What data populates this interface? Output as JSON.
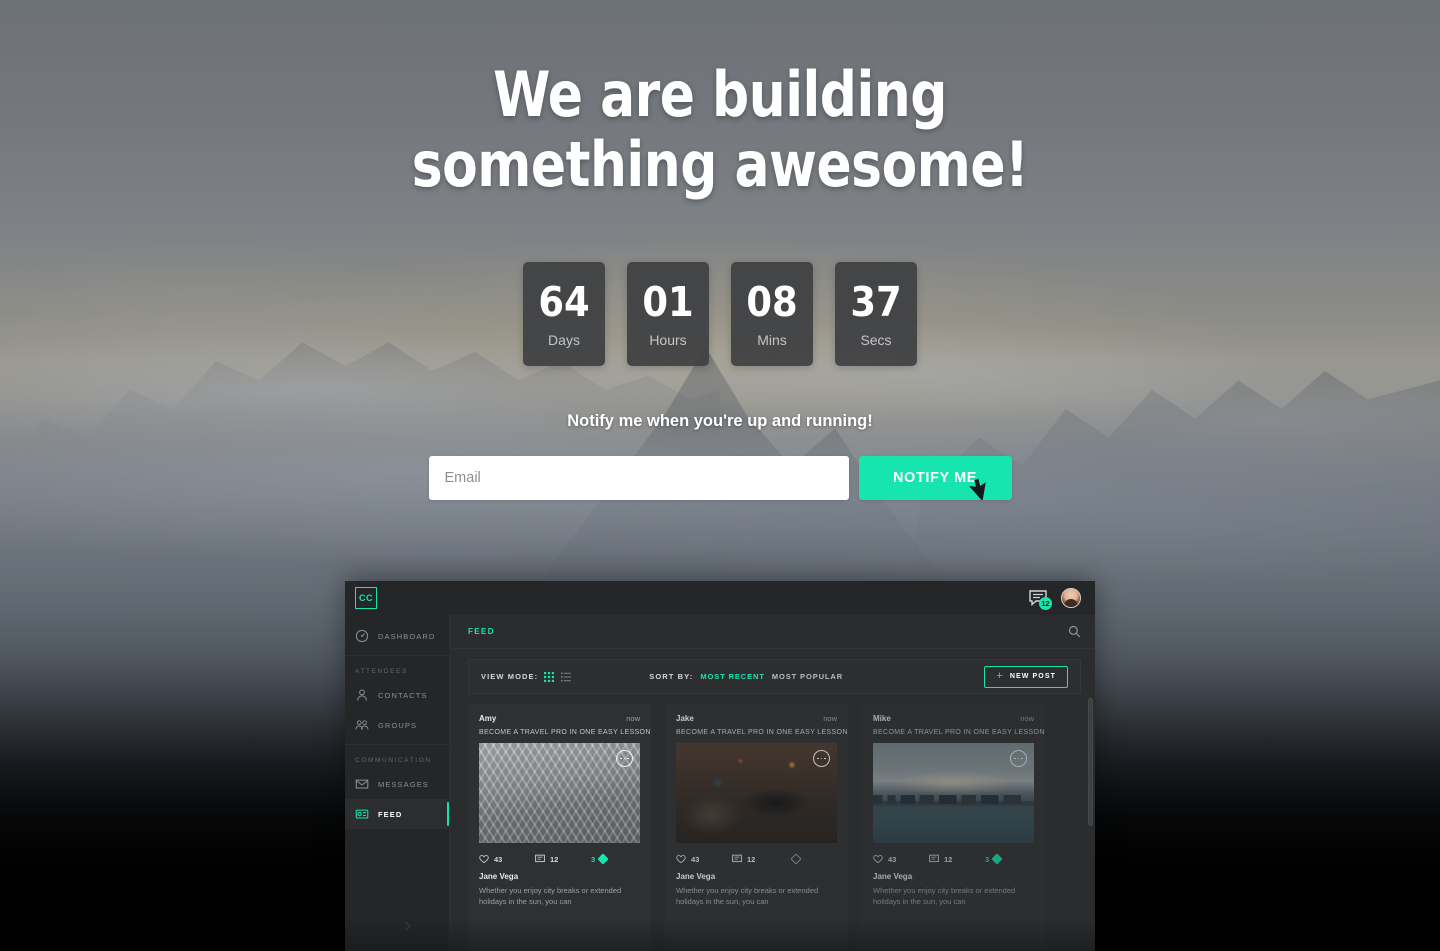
{
  "theme": {
    "accent": "#16e5b0",
    "hero_text": "#ffffff",
    "app_bg": "#2a2c2e",
    "sidebar_bg": "#242628",
    "card_bg": "#2e3032"
  },
  "hero": {
    "headline": "We are building something awesome!",
    "notify_prompt": "Notify me when you're up and running!",
    "countdown": [
      {
        "value": "64",
        "label": "Days"
      },
      {
        "value": "01",
        "label": "Hours"
      },
      {
        "value": "08",
        "label": "Mins"
      },
      {
        "value": "37",
        "label": "Secs"
      }
    ],
    "email_placeholder": "Email",
    "email_value": "",
    "notify_button": "NOTIFY ME"
  },
  "app": {
    "logo": "CC",
    "topbar": {
      "messages_badge": "12",
      "messages_icon": "chat-bubble-icon",
      "avatar_icon": "user-avatar"
    },
    "sidebar": {
      "dashboard": {
        "label": "DASHBOARD",
        "icon": "speedometer-icon"
      },
      "sections": [
        {
          "title": "ATTENDEES",
          "items": [
            {
              "label": "CONTACTS",
              "icon": "user-icon",
              "active": false
            },
            {
              "label": "GROUPS",
              "icon": "users-icon",
              "active": false
            }
          ]
        },
        {
          "title": "COMMUNICATION",
          "items": [
            {
              "label": "MESSAGES",
              "icon": "envelope-icon",
              "active": false
            },
            {
              "label": "FEED",
              "icon": "feed-icon",
              "active": true
            }
          ]
        }
      ],
      "collapse_icon": "chevron-right-icon"
    },
    "breadcrumb": "FEED",
    "search_icon": "search-icon",
    "toolbar": {
      "view_mode_label": "VIEW MODE:",
      "grid_icon": "grid-view-icon",
      "list_icon": "list-view-icon",
      "sort_by_label": "SORT BY:",
      "sort_options": [
        {
          "label": "MOST RECENT",
          "active": true
        },
        {
          "label": "MOST POPULAR",
          "active": false
        }
      ],
      "new_post_label": "NEW POST",
      "new_post_icon": "plus-icon"
    },
    "posts": [
      {
        "author": "Amy",
        "time": "now",
        "title": "BECOME A TRAVEL PRO IN ONE EASY LESSON",
        "image": "eiffel-tower-photo",
        "likes": "43",
        "comments": "12",
        "shares": "3",
        "footer_name": "Jane Vega",
        "footer_body": "Whether you enjoy city breaks or extended holidays in the sun, you can"
      },
      {
        "author": "Jake",
        "time": "now",
        "title": "BECOME A TRAVEL PRO IN ONE EASY LESSON",
        "image": "city-street-photo",
        "likes": "43",
        "comments": "12",
        "shares": "",
        "footer_name": "Jane Vega",
        "footer_body": "Whether you enjoy city breaks or extended holidays in the sun, you can"
      },
      {
        "author": "Mike",
        "time": "now",
        "title": "BECOME A TRAVEL PRO IN ONE EASY LESSON",
        "image": "city-skyline-photo",
        "likes": "43",
        "comments": "12",
        "shares": "3",
        "footer_name": "Jane Vega",
        "footer_body": "Whether you enjoy city breaks or extended holidays in the sun, you can"
      }
    ]
  }
}
